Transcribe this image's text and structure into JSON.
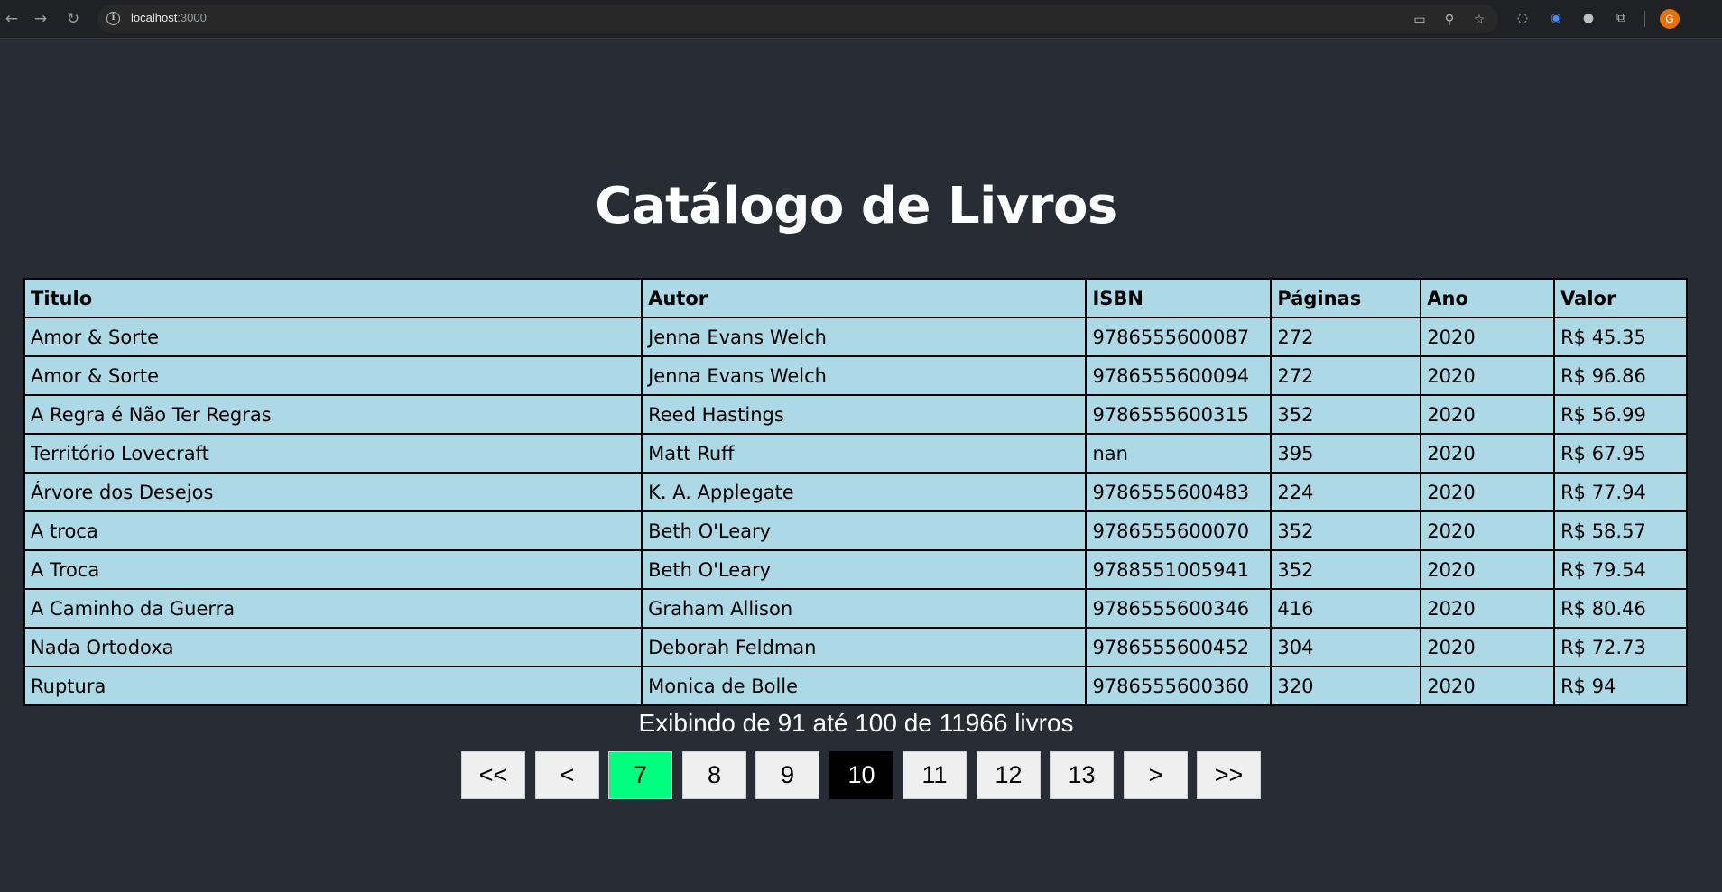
{
  "browser": {
    "url_host": "localhost",
    "url_port": ":3000",
    "profile_initial": "G"
  },
  "page": {
    "title": "Catálogo de Livros"
  },
  "table": {
    "headers": [
      "Titulo",
      "Autor",
      "ISBN",
      "Páginas",
      "Ano",
      "Valor"
    ],
    "rows": [
      [
        "Amor & Sorte",
        "Jenna Evans Welch",
        "9786555600087",
        "272",
        "2020",
        "R$ 45.35"
      ],
      [
        "Amor & Sorte",
        "Jenna Evans Welch",
        "9786555600094",
        "272",
        "2020",
        "R$ 96.86"
      ],
      [
        "A Regra é Não Ter Regras",
        "Reed Hastings",
        "9786555600315",
        "352",
        "2020",
        "R$ 56.99"
      ],
      [
        "Território Lovecraft",
        "Matt Ruff",
        "nan",
        "395",
        "2020",
        "R$ 67.95"
      ],
      [
        "Árvore dos Desejos",
        "K. A. Applegate",
        "9786555600483",
        "224",
        "2020",
        "R$ 77.94"
      ],
      [
        "A troca",
        "Beth O'Leary",
        "9786555600070",
        "352",
        "2020",
        "R$ 58.57"
      ],
      [
        "A Troca",
        "Beth O'Leary",
        "9788551005941",
        "352",
        "2020",
        "R$ 79.54"
      ],
      [
        "A Caminho da Guerra",
        "Graham Allison",
        "9786555600346",
        "416",
        "2020",
        "R$ 80.46"
      ],
      [
        "Nada Ortodoxa",
        "Deborah Feldman",
        "9786555600452",
        "304",
        "2020",
        "R$ 72.73"
      ],
      [
        "Ruptura",
        "Monica de Bolle",
        "9786555600360",
        "320",
        "2020",
        "R$ 94"
      ]
    ]
  },
  "summary": "Exibindo de 91 até 100 de 11966 livros",
  "pagination": {
    "first": "<<",
    "prev": "<",
    "pages": [
      "7",
      "8",
      "9",
      "10",
      "11",
      "12",
      "13"
    ],
    "next": ">",
    "last": ">>",
    "current_page_color": "#00ff7f",
    "active_page_color": "#000000"
  }
}
